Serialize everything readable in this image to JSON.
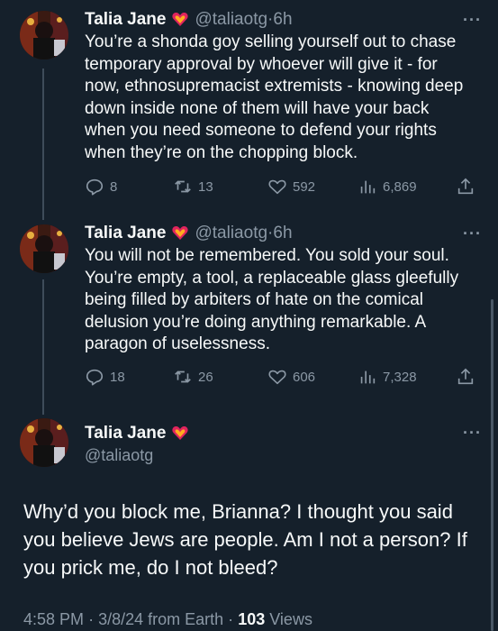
{
  "tweets": [
    {
      "name": "Talia Jane",
      "handle": "@taliaotg",
      "time": "6h",
      "text": "You’re a shonda goy selling yourself out to chase temporary approval by whoever will give it - for now, ethnosupremacist extremists - knowing deep down inside none of them will have your back when you need someone to defend your rights when they’re on the chopping block.",
      "replies": "8",
      "reposts": "13",
      "likes": "592",
      "views": "6,869"
    },
    {
      "name": "Talia Jane",
      "handle": "@taliaotg",
      "time": "6h",
      "text": "You will not be remembered. You sold your soul. You’re empty, a tool, a replaceable glass gleefully being filled by arbiters of hate on the comical delusion you’re doing anything remarkable. A paragon of uselessness.",
      "replies": "18",
      "reposts": "26",
      "likes": "606",
      "views": "7,328"
    }
  ],
  "main": {
    "name": "Talia Jane",
    "handle": "@taliaotg",
    "text": "Why’d you block me, Brianna? I thought you said you believe Jews are people. Am I not a person? If you prick me, do I not bleed?",
    "time": "4:58 PM",
    "date": "3/8/24 from Earth",
    "views_count": "103",
    "views_label": "Views"
  },
  "separator": "·",
  "more_label": "···",
  "colors": {
    "background": "#15202b",
    "text": "#f7f9f9",
    "secondary": "#8b98a5",
    "heart": "#e0245e"
  }
}
